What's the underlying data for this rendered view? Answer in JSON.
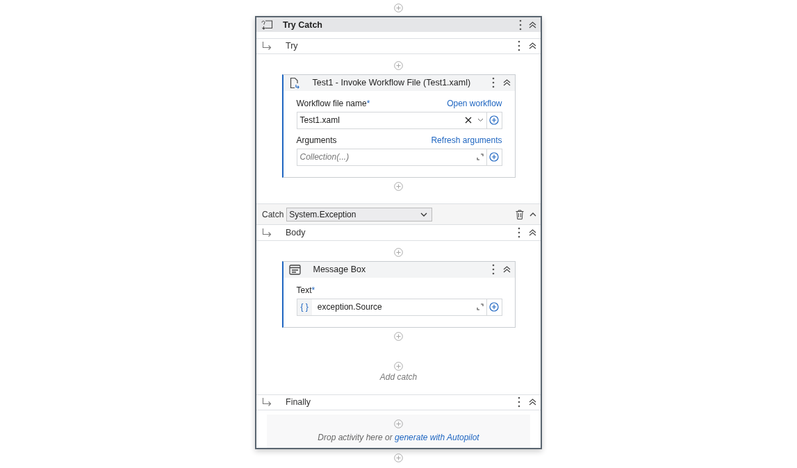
{
  "title": "Try Catch",
  "try": {
    "label": "Try",
    "activity": {
      "kind": "invoke",
      "title": "Test1 - Invoke Workflow File (Test1.xaml)",
      "fields": [
        {
          "kind": "dropdown",
          "label": "Workflow file name",
          "required_mark": "*",
          "link": "Open workflow",
          "value": "Test1.xaml"
        },
        {
          "kind": "collection",
          "label": "Arguments",
          "link": "Refresh arguments",
          "placeholder": "Collection(...)"
        }
      ]
    }
  },
  "catch": {
    "label": "Catch",
    "exception_type": "System.Exception",
    "body": {
      "label": "Body",
      "activity": {
        "kind": "message",
        "title": "Message Box",
        "fields": [
          {
            "kind": "expression",
            "label": "Text",
            "required_mark": "*",
            "prefix": "{ }",
            "value": "exception.Source"
          }
        ]
      }
    }
  },
  "add_catch": "Add catch",
  "finally": {
    "label": "Finally",
    "drop_hint": "Drop activity here or",
    "drop_link": "generate with Autopilot"
  }
}
